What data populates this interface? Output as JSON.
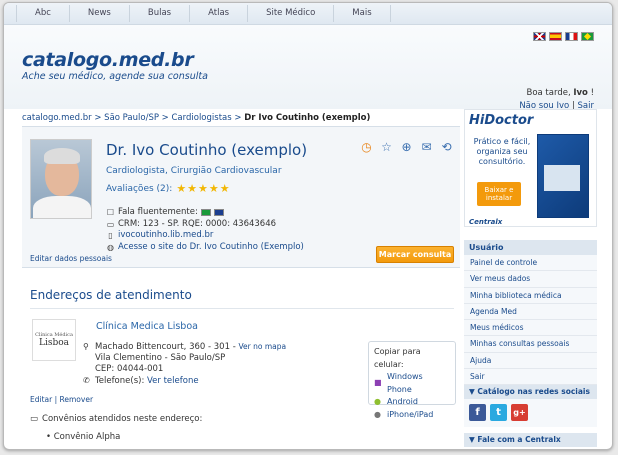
{
  "topnav": [
    "Abc",
    "News",
    "Bulas",
    "Atlas",
    "Site Médico",
    "Mais"
  ],
  "header": {
    "logo": "catalogo.med.br",
    "tagline": "Ache seu médico, agende sua consulta",
    "greeting_prefix": "Boa tarde, ",
    "user": "Ivo",
    "greeting_suffix": " !",
    "not_you": "Não sou Ivo",
    "sep": " | ",
    "logout": "Sair"
  },
  "breadcrumb": {
    "items": [
      "catalogo.med.br",
      "São Paulo/SP",
      "Cardiologistas"
    ],
    "sep": " > ",
    "current": "Dr Ivo Coutinho (exemplo)"
  },
  "profile": {
    "name": "Dr. Ivo Coutinho (exemplo)",
    "specialty": "Cardiologista, Cirurgião Cardiovascular",
    "reviews_label": "Avaliações (2):",
    "stars": "★★★★★",
    "fluent_label": "Fala fluentemente:",
    "crm": "CRM: 123 - SP. RQE: 0000: 43643646",
    "url": "ivocoutinho.lib.med.br",
    "site_link": "Acesse o site do Dr. Ivo Coutinho (Exemplo)",
    "edit_link": "Editar dados pessoais",
    "book_button": "Marcar consulta"
  },
  "addresses": {
    "title": "Endereços de atendimento",
    "clinic_logo_small": "Clínica Médica",
    "clinic_logo_big": "Lisboa",
    "clinic_name": "Clínica Medica Lisboa",
    "street": "Machado Bittencourt, 360 - 301 - ",
    "map_link": "Ver no mapa",
    "district": "Vila Clementino - São Paulo/SP",
    "cep": "CEP: 04044-001",
    "phone_label": "Telefone(s): ",
    "phone_link": "Ver telefone",
    "copy_title": "Copiar para celular:",
    "copy_options": [
      "Windows Phone",
      "Android",
      "iPhone/iPad"
    ],
    "edit": "Editar",
    "remove": "Remover",
    "convenios_label": "Convênios atendidos neste endereço:",
    "convenios": [
      "Convênio Alpha"
    ]
  },
  "sidebar": {
    "ad_title": "HiDoctor",
    "ad_text": "Prático e fácil, organiza seu consultório.",
    "ad_button": "Baixar e instalar",
    "ad_brand": "Centralx",
    "menu_title": "Usuário",
    "menu_items": [
      "Painel de controle",
      "Ver meus dados",
      "Minha biblioteca médica",
      "Agenda Med",
      "Meus médicos",
      "Minhas consultas pessoais",
      "Ajuda",
      "Sair"
    ],
    "social_title": "▼ Catálogo nas redes sociais",
    "contact_title": "▼ Fale com a Centralx"
  }
}
